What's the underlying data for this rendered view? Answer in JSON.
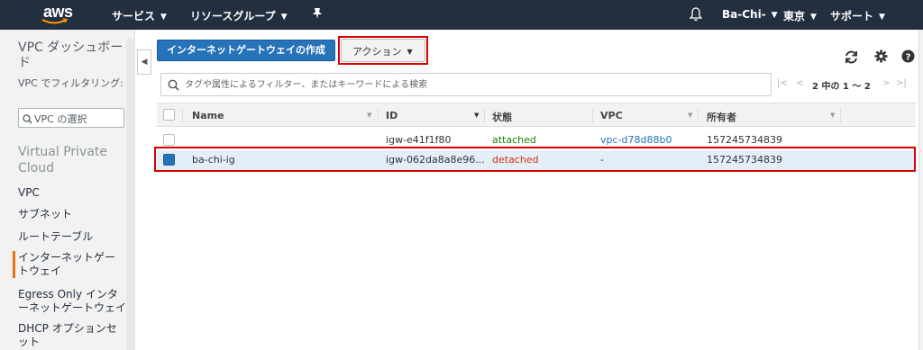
{
  "nav": {
    "logo": "aws",
    "services": "サービス",
    "resource_groups": "リソースグループ",
    "user": "Ba-Chi-",
    "region": "東京",
    "support": "サポート"
  },
  "sidebar": {
    "title": "VPC ダッシュボード",
    "filter_label": "VPC でフィルタリング:",
    "select_placeholder": "VPC の選択",
    "section": "Virtual Private Cloud",
    "items": [
      {
        "label": "VPC"
      },
      {
        "label": "サブネット"
      },
      {
        "label": "ルートテーブル"
      },
      {
        "label": "インターネットゲートウェイ"
      },
      {
        "label": "Egress Only インターネットゲートウェイ"
      },
      {
        "label": "DHCP オプションセット"
      }
    ]
  },
  "toolbar": {
    "create_label": "インターネットゲートウェイの作成",
    "actions_label": "アクション"
  },
  "search": {
    "placeholder": "タグや属性によるフィルター、またはキーワードによる検索"
  },
  "pager": {
    "text": "2 中の 1 ～ 2"
  },
  "table": {
    "columns": [
      "Name",
      "ID",
      "状態",
      "VPC",
      "所有者"
    ],
    "rows": [
      {
        "name": "",
        "id": "igw-e41f1f80",
        "state": "attached",
        "vpc": "vpc-d78d88b0",
        "owner": "157245734839",
        "selected": false
      },
      {
        "name": "ba-chi-ig",
        "id": "igw-062da8a8e96...",
        "state": "detached",
        "vpc": "-",
        "owner": "157245734839",
        "selected": true
      }
    ]
  },
  "colors": {
    "nav_bg": "#232f3e",
    "primary": "#2773b9",
    "attached": "#1d8102",
    "detached": "#d13212",
    "highlight": "#d90000",
    "active_accent": "#ec7211"
  }
}
